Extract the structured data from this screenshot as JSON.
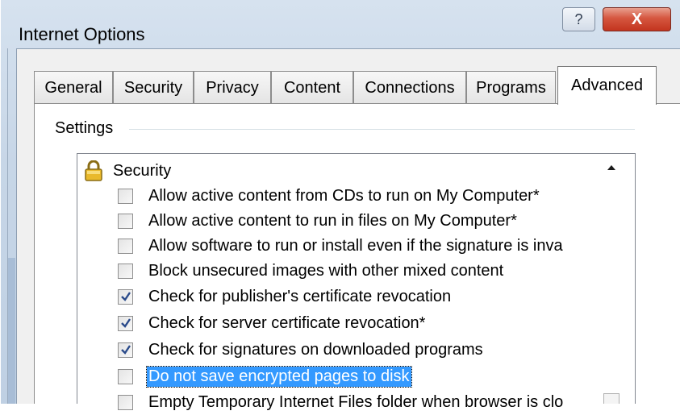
{
  "window": {
    "title": "Internet Options",
    "help_glyph": "?",
    "close_glyph": "X",
    "help_icon": "help-icon",
    "close_icon": "close-icon"
  },
  "tabs": [
    {
      "label": "General",
      "active": false
    },
    {
      "label": "Security",
      "active": false
    },
    {
      "label": "Privacy",
      "active": false
    },
    {
      "label": "Content",
      "active": false
    },
    {
      "label": "Connections",
      "active": false
    },
    {
      "label": "Programs",
      "active": false
    },
    {
      "label": "Advanced",
      "active": true
    }
  ],
  "settings": {
    "label": "Settings",
    "group": {
      "label": "Security",
      "icon": "lock-icon"
    },
    "items": [
      {
        "label": "Allow active content from CDs to run on My Computer*",
        "checked": false,
        "selected": false
      },
      {
        "label": "Allow active content to run in files on My Computer*",
        "checked": false,
        "selected": false
      },
      {
        "label": "Allow software to run or install even if the signature is inva",
        "checked": false,
        "selected": false
      },
      {
        "label": "Block unsecured images with other mixed content",
        "checked": false,
        "selected": false
      },
      {
        "label": "Check for publisher's certificate revocation",
        "checked": true,
        "selected": false
      },
      {
        "label": "Check for server certificate revocation*",
        "checked": true,
        "selected": false
      },
      {
        "label": "Check for signatures on downloaded programs",
        "checked": true,
        "selected": false
      },
      {
        "label": "Do not save encrypted pages to disk",
        "checked": false,
        "selected": true
      },
      {
        "label": "Empty Temporary Internet Files folder when browser is clo",
        "checked": false,
        "selected": false
      }
    ]
  },
  "colors": {
    "selection": "#3399ff",
    "close_button": "#c3351f"
  }
}
